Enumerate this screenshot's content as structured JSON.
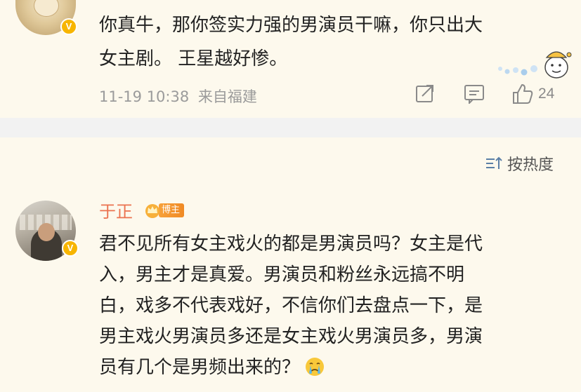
{
  "comment1": {
    "text_lines": [
      "你真牛，那你签实力强的男演员干嘛，你只出大",
      "女主剧。 王星越好惨。"
    ],
    "timestamp": "11-19 10:38",
    "location": "来自福建",
    "like_count": "24",
    "icons": [
      "share-icon",
      "comment-icon",
      "like-icon"
    ]
  },
  "sort": {
    "label": "按热度",
    "icon": "sort-icon"
  },
  "comment2": {
    "username": "于正",
    "badge": "博主",
    "text_lines": [
      "君不见所有女主戏火的都是男演员吗？女主是代",
      "入，男主才是真爱。男演员和粉丝永远搞不明",
      "白，戏多不代表戏好，不信你们去盘点一下，是",
      "男主戏火男演员多还是女主戏火男演员多，男演",
      "员有几个是男频出来的？"
    ],
    "emoji": "crying-face-emoji"
  },
  "colors": {
    "background": "#fdf9ed",
    "username": "#eb7350",
    "verified_badge": "#f7b500",
    "separator": "#f2f2f2"
  }
}
